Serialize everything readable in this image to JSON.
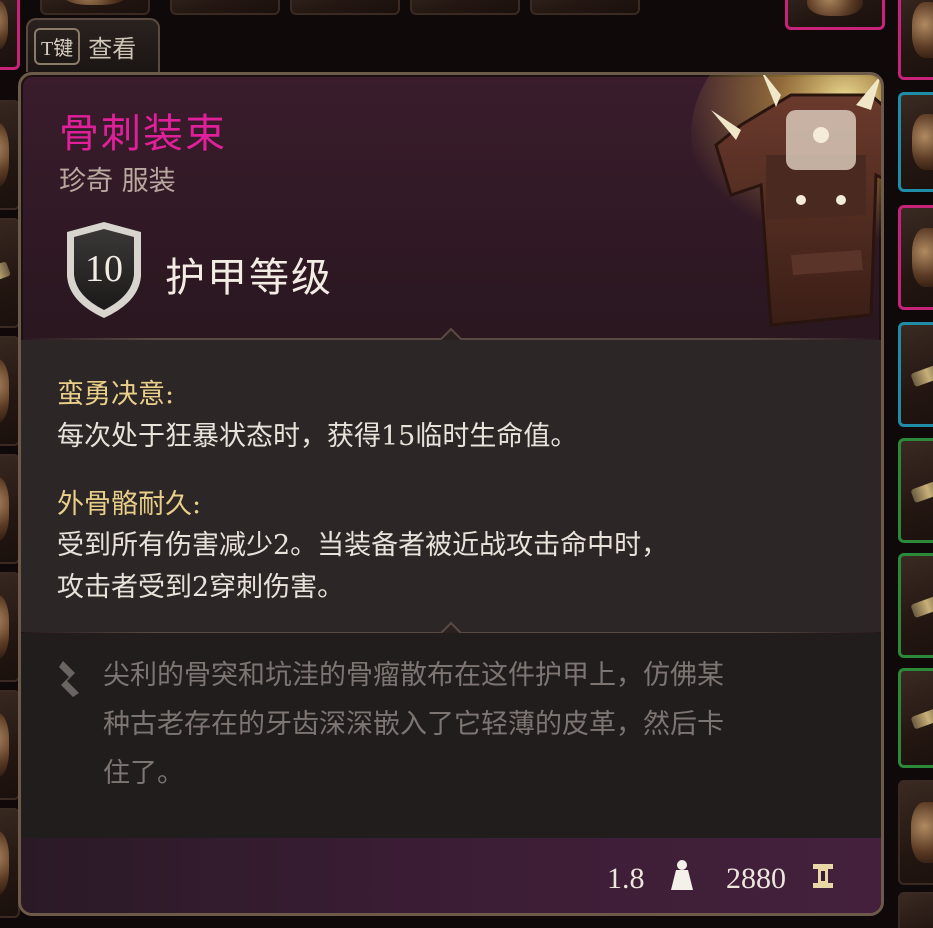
{
  "hint": {
    "key": "T键",
    "label": "查看"
  },
  "item": {
    "name": "骨刺装束",
    "subtitle": "珍奇 服装",
    "armor_value": "10",
    "armor_label": "护甲等级"
  },
  "properties": [
    {
      "title": "蛮勇决意:",
      "lines": [
        "每次处于狂暴状态时，获得15临时生命值。"
      ]
    },
    {
      "title": "外骨骼耐久:",
      "lines": [
        "受到所有伤害减少2。当装备者被近战攻击命中时，",
        "攻击者受到2穿刺伤害。"
      ]
    }
  ],
  "description": {
    "lines": [
      "尖利的骨突和坑洼的骨瘤散布在这件护甲上，仿佛某",
      "种古老存在的牙齿深深嵌入了它轻薄的皮革，然后卡",
      "住了。"
    ]
  },
  "footer": {
    "weight": "1.8",
    "price": "2880"
  },
  "colors": {
    "rarity_name": "#e0209a",
    "property_title": "#e9cf8a",
    "description_text": "#7d7571",
    "slot_pink": "#c8237a",
    "slot_teal": "#1f8da8",
    "slot_green": "#2a8a3a"
  },
  "icons": [
    "shield-icon",
    "quill-icon",
    "weight-icon",
    "coin-icon",
    "item-armor-art"
  ]
}
